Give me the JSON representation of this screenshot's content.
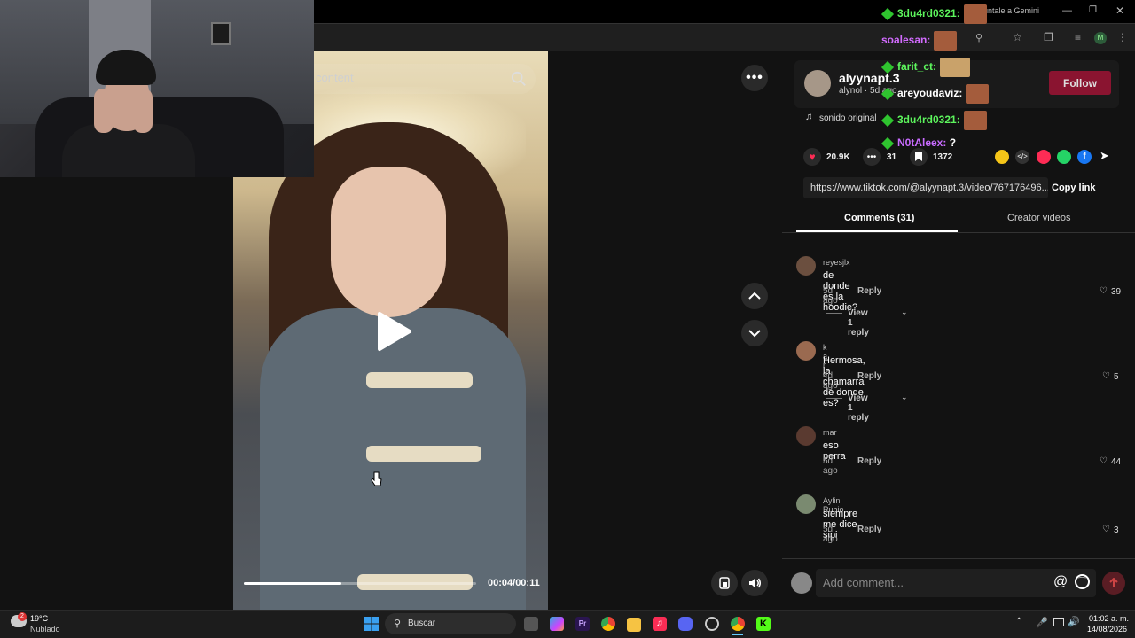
{
  "search": {
    "placeholder": "content"
  },
  "video": {
    "time": "00:04/00:11",
    "progress": 0.42
  },
  "profile": {
    "username": "alyynapt.3",
    "subline": "alynol · 5d ago",
    "follow_label": "Follow",
    "music": "sonido original"
  },
  "stats": {
    "likes": "20.9K",
    "comments": "31",
    "saves": "1372"
  },
  "share": {
    "url": "https://www.tiktok.com/@alyynapt.3/video/767176496...",
    "copy_label": "Copy link"
  },
  "tabs": {
    "comments": "Comments (31)",
    "creator": "Creator videos"
  },
  "comments": [
    {
      "user": "reyesjlx",
      "text": "de donde es la hoodie?",
      "time": "5d ago",
      "reply": "Reply",
      "likes": "39",
      "view_replies": "View 1 reply"
    },
    {
      "user": "k a r o l",
      "text": "Hermosa, la chamarra de donde es?",
      "time": "4d ago",
      "reply": "Reply",
      "likes": "5",
      "view_replies": "View 1 reply"
    },
    {
      "user": "mar",
      "text": "eso perra",
      "time": "5d ago",
      "reply": "Reply",
      "likes": "44"
    },
    {
      "user": "Aylin Rubio",
      "text": "siempre me dice sipi",
      "time": "5d ago",
      "reply": "Reply",
      "likes": "3"
    }
  ],
  "add_comment": {
    "placeholder": "Add comment..."
  },
  "chat": [
    {
      "user": "3du4rd0321:",
      "color": "#5df55d",
      "text": ""
    },
    {
      "user": "soalesan:",
      "color": "#d26bff",
      "text": ""
    },
    {
      "user": "farit_ct:",
      "color": "#5df55d",
      "text": ""
    },
    {
      "user": "areyoudaviz:",
      "color": "#ffffff",
      "text": ""
    },
    {
      "user": "3du4rd0321:",
      "color": "#5df55d",
      "text": ""
    },
    {
      "user": "N0tAleex:",
      "color": "#c86bff",
      "text": "?"
    }
  ],
  "browser": {
    "gemini_label": "Pregúntale a Gemini"
  },
  "taskbar": {
    "weather_temp": "19°C",
    "weather_desc": "Nublado",
    "search_label": "Buscar",
    "clock_time": "01:02 a. m.",
    "clock_date": "14/08/2026"
  }
}
